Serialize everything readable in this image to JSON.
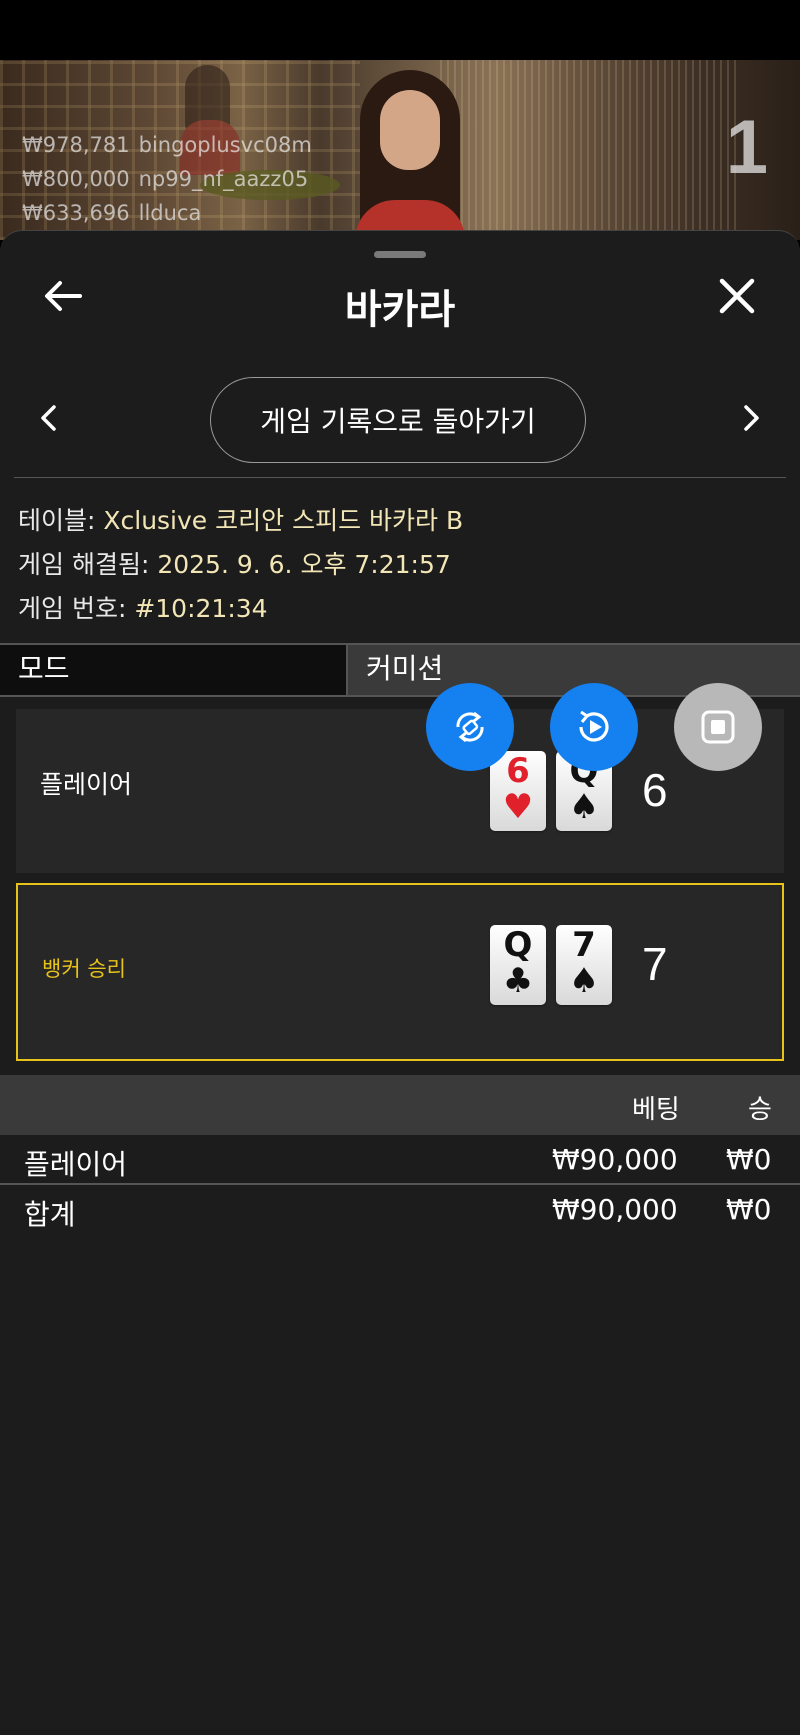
{
  "video": {
    "round_number": "1",
    "winners": [
      {
        "amount": "₩978,781",
        "user": "bingoplusvc08m"
      },
      {
        "amount": "₩800,000",
        "user": "np99_nf_aazz05"
      },
      {
        "amount": "₩633,696",
        "user": "llduca"
      }
    ]
  },
  "header": {
    "title": "바카라"
  },
  "nav": {
    "back_history_label": "게임 기록으로 돌아가기"
  },
  "details": {
    "table_label": "테이블: ",
    "table_value": "Xclusive 코리안 스피드 바카라 B",
    "resolved_label": "게임 해결됨: ",
    "resolved_value": "2025. 9. 6. 오후 7:21:57",
    "number_label": "게임 번호: ",
    "number_value": "#10:21:34"
  },
  "mode": {
    "label": "모드",
    "value": "커미션"
  },
  "hands": {
    "player": {
      "label": "플레이어",
      "score": "6",
      "cards": [
        {
          "rank": "6",
          "suit": "♥",
          "color": "#e0202a"
        },
        {
          "rank": "Q",
          "suit": "♠",
          "color": "#111111"
        }
      ]
    },
    "banker": {
      "label": "뱅커 승리",
      "score": "7",
      "cards": [
        {
          "rank": "Q",
          "suit": "♣",
          "color": "#111111"
        },
        {
          "rank": "7",
          "suit": "♠",
          "color": "#111111"
        }
      ]
    }
  },
  "bets": {
    "headers": {
      "bet": "베팅",
      "win": "승"
    },
    "rows": [
      {
        "name": "플레이어",
        "bet": "₩90,000",
        "win": "₩0"
      }
    ],
    "total": {
      "name": "합계",
      "bet": "₩90,000",
      "win": "₩0"
    }
  },
  "colors": {
    "accent_gold": "#e6c21a",
    "fab_blue": "#1580f0",
    "value_text": "#f3e6b6"
  },
  "icons": {
    "back": "arrow-left-icon",
    "close": "close-icon",
    "prev": "chevron-left-icon",
    "next": "chevron-right-icon",
    "fab1": "rotate-lock-icon",
    "fab2": "replay-play-icon",
    "fab3": "stop-icon"
  }
}
